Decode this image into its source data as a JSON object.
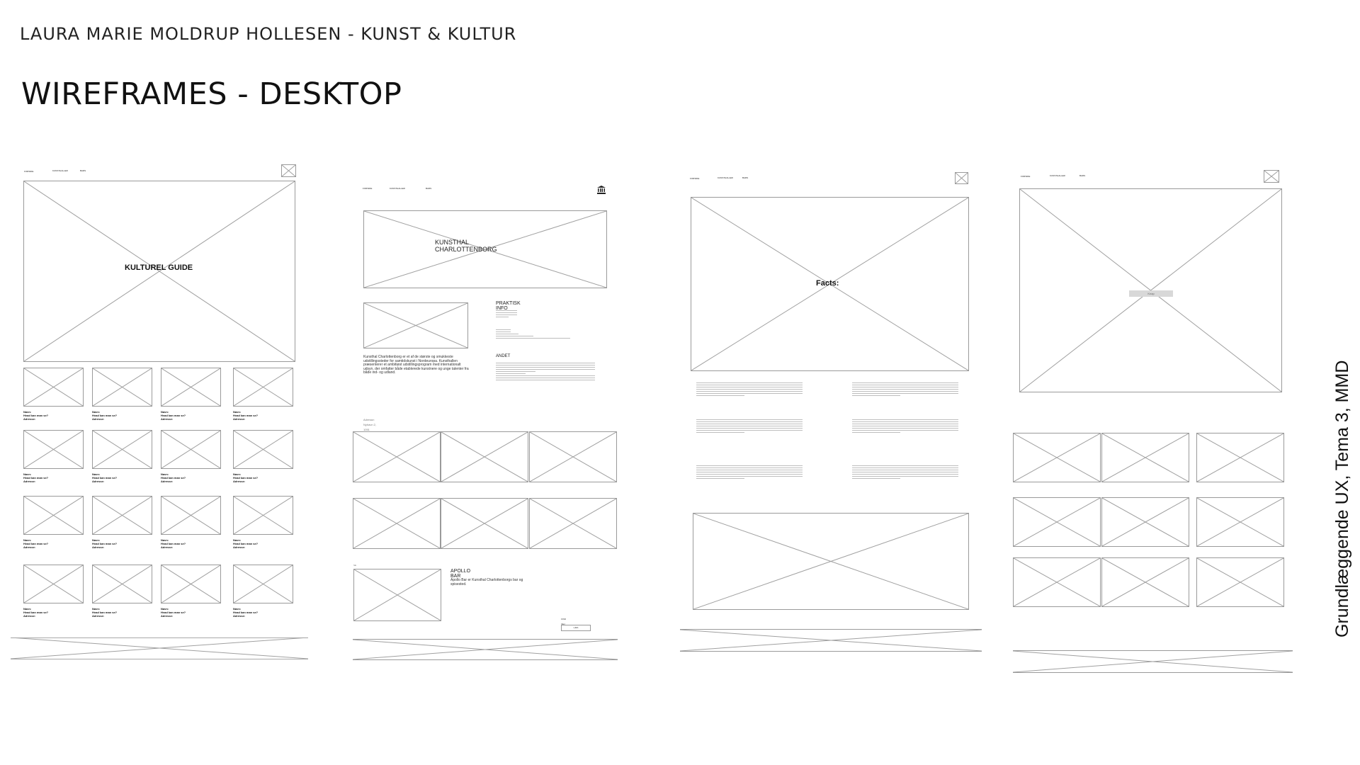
{
  "header": {
    "author": "LAURA MARIE MOLDRUP HOLLESEN - KUNST & KULTUR",
    "title": "WIREFRAMES - DESKTOP",
    "side_caption": "Grundlæggende UX, Tema 3, MMD"
  },
  "wireframe1": {
    "nav": [
      "FORSIDE",
      "KUNSTHALLER",
      "BARS"
    ],
    "hero_label": "KULTUREL GUIDE",
    "card_lines": [
      "Navn:",
      "Hvad kan man se?",
      "Adresse:"
    ]
  },
  "wireframe2": {
    "nav": [
      "FORSIDE",
      "KUNSTHALLER",
      "BARS"
    ],
    "hero_label": "KUNSTHAL CHARLOTTENBORG",
    "info_title": "PRAKTISK INFO",
    "other_title": "ANDET",
    "intro": "Kunsthal Charlottenborg er et af de største og smukkeste udstillingssteder for samtidskunst i Nordeuropa. Kunsthallen præsenterer et ambitiøst udstillingsprogram med internationalt udsyn, der omfatter både etablerede kunstnere og unge talenter fra både ind- og udland.",
    "address": "Adresse: Nyhavn 2, 1051 København",
    "section_label": "SE OGSÅ",
    "bar_title": "APOLLO BAR",
    "bar_text": "Apollo Bar er Kunsthal Charlottenborgs bar og spisested.",
    "more_label": "FIND VEJ",
    "button_label": "LÆS"
  },
  "wireframe3": {
    "nav": [
      "FORSIDE",
      "KUNSTHALLER",
      "BARS"
    ],
    "hero_label": "Facts:"
  },
  "wireframe4": {
    "nav": [
      "FORSIDE",
      "KUNSTHALLER",
      "BARS"
    ],
    "button_label": "Knap"
  }
}
